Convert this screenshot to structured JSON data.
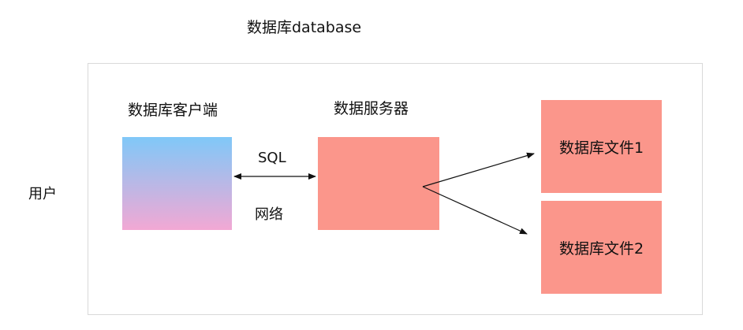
{
  "title": "数据库database",
  "user_label": "用户",
  "client": {
    "label": "数据库客户端"
  },
  "server": {
    "label": "数据服务器"
  },
  "connection": {
    "protocol": "SQL",
    "medium": "网络"
  },
  "files": [
    {
      "label": "数据库文件1"
    },
    {
      "label": "数据库文件2"
    }
  ],
  "colors": {
    "server_fill": "#fb968b",
    "file_fill": "#fb968b",
    "client_gradient_top": "#80c8f8",
    "client_gradient_bottom": "#f2a8d4",
    "frame_border": "#d9d9d9"
  }
}
